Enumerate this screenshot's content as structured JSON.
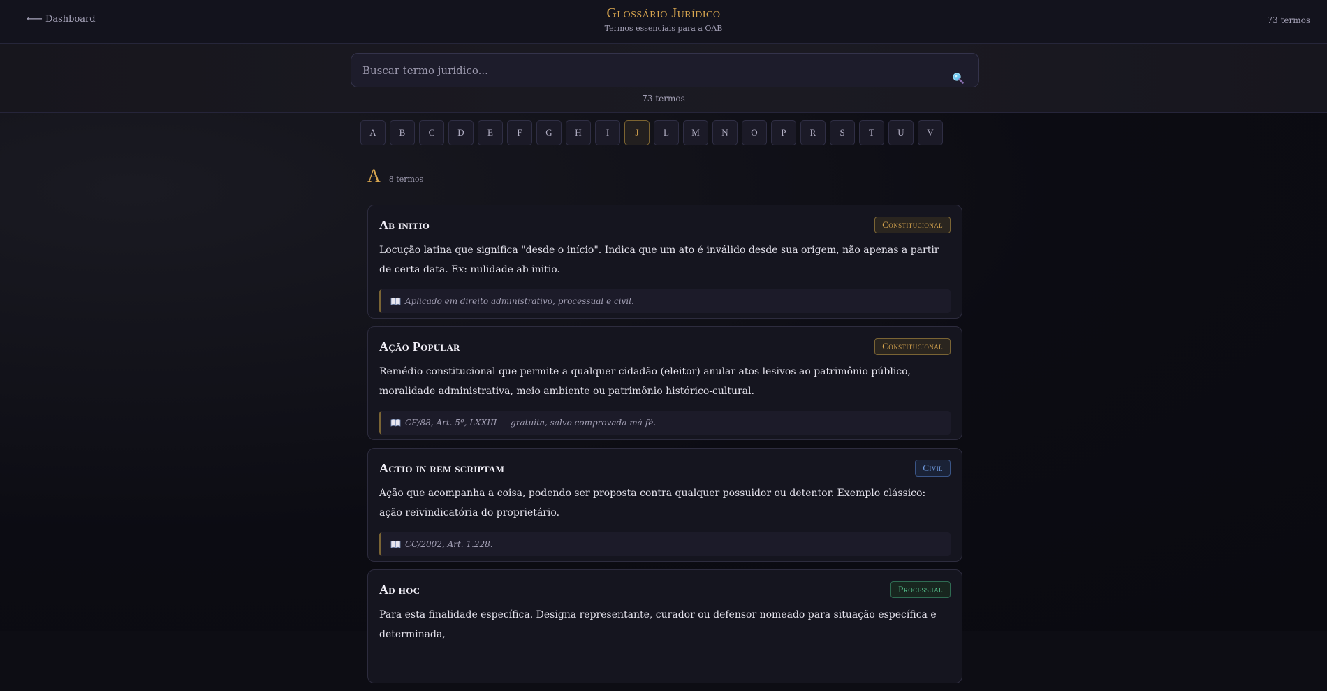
{
  "header": {
    "back_arrow": "⟵",
    "back_label": "Dashboard",
    "title": "Glossário Jurídico",
    "subtitle": "Termos essenciais para a OAB",
    "total_count": "73 termos"
  },
  "search": {
    "placeholder": "Buscar termo jurídico...",
    "value": "",
    "results_count": "73 termos"
  },
  "alphabet": {
    "letters": [
      "A",
      "B",
      "C",
      "D",
      "E",
      "F",
      "G",
      "H",
      "I",
      "J",
      "L",
      "M",
      "N",
      "O",
      "P",
      "R",
      "S",
      "T",
      "U",
      "V"
    ],
    "active": "J"
  },
  "section": {
    "letter": "A",
    "count": "8 termos"
  },
  "terms": [
    {
      "title": "Ab initio",
      "category": "Constitucional",
      "category_key": "constitucional",
      "definition": "Locução latina que significa \"desde o início\". Indica que um ato é inválido desde sua origem, não apenas a partir de certa data. Ex: nulidade ab initio.",
      "reference": "Aplicado em direito administrativo, processual e civil."
    },
    {
      "title": "Ação Popular",
      "category": "Constitucional",
      "category_key": "constitucional",
      "definition": "Remédio constitucional que permite a qualquer cidadão (eleitor) anular atos lesivos ao patrimônio público, moralidade administrativa, meio ambiente ou patrimônio histórico-cultural.",
      "reference": "CF/88, Art. 5º, LXXIII — gratuita, salvo comprovada má-fé."
    },
    {
      "title": "Actio in rem scriptam",
      "category": "Civil",
      "category_key": "civil",
      "definition": "Ação que acompanha a coisa, podendo ser proposta contra qualquer possuidor ou detentor. Exemplo clássico: ação reivindicatória do proprietário.",
      "reference": "CC/2002, Art. 1.228."
    },
    {
      "title": "Ad hoc",
      "category": "Processual",
      "category_key": "processual",
      "definition": "Para esta finalidade específica. Designa representante, curador ou defensor nomeado para situação específica e determinada,",
      "reference": ""
    }
  ],
  "colors": {
    "accent": "#d7a54f",
    "background": "#0d0d14",
    "card": "#15151f",
    "civil": "#6f9be0",
    "processual": "#56c28e"
  }
}
